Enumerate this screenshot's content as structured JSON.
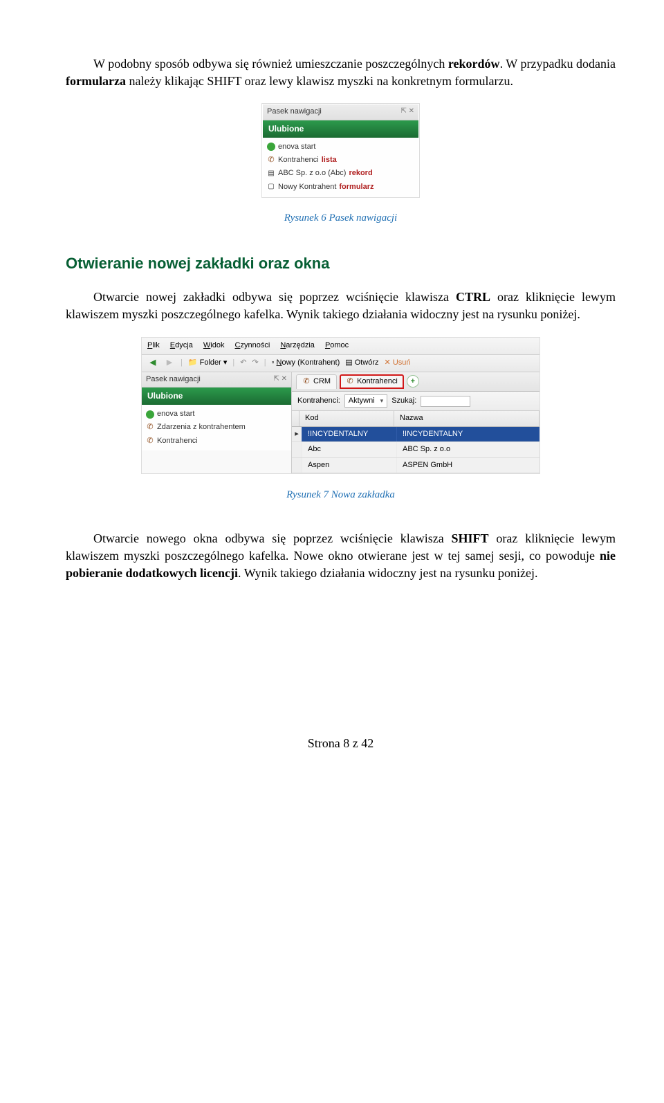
{
  "body": {
    "p1a": "W podobny sposób odbywa się również umieszczanie poszczególnych ",
    "p1b": "rekordów",
    "p1c": ". W przypadku dodania ",
    "p1d": "formularza",
    "p1e": " należy klikając SHIFT oraz lewy klawisz myszki na konkretnym formularzu.",
    "caption1": "Rysunek 6 Pasek nawigacji",
    "section_heading": "Otwieranie nowej zakładki oraz okna",
    "p2a": "Otwarcie nowej zakładki odbywa się poprzez wciśnięcie klawisza ",
    "p2b": "CTRL",
    "p2c": " oraz kliknięcie lewym klawiszem myszki poszczególnego kafelka. Wynik takiego działania widoczny jest na rysunku poniżej.",
    "caption2": "Rysunek 7 Nowa zakładka",
    "p3a": "Otwarcie nowego okna odbywa się poprzez wciśnięcie klawisza ",
    "p3b": "SHIFT",
    "p3c": " oraz kliknięcie lewym klawiszem myszki poszczególnego kafelka. Nowe okno otwierane jest w tej samej sesji, co powoduje ",
    "p3d": "nie pobieranie dodatkowych licencji",
    "p3e": ". Wynik takiego działania widoczny jest na rysunku poniżej."
  },
  "fig1": {
    "title": "Pasek nawigacji",
    "header": "Ulubione",
    "items": [
      {
        "icon": "green-dot",
        "label": "enova start",
        "suffix": ""
      },
      {
        "icon": "phone",
        "label": "Kontrahenci",
        "suffix": "lista"
      },
      {
        "icon": "doc-blue",
        "label": "ABC Sp. z o.o (Abc)",
        "suffix": "rekord"
      },
      {
        "icon": "doc-plain",
        "label": "Nowy Kontrahent",
        "suffix": "formularz"
      }
    ]
  },
  "fig2": {
    "menu": [
      "Plik",
      "Edycja",
      "Widok",
      "Czynności",
      "Narzędzia",
      "Pomoc"
    ],
    "toolbar": {
      "folder": "Folder",
      "new": "Nowy (Kontrahent)",
      "open": "Otwórz",
      "delete": "Usuń"
    },
    "nav": {
      "title": "Pasek nawigacji",
      "header": "Ulubione",
      "items": [
        {
          "icon": "green-dot",
          "label": "enova start"
        },
        {
          "icon": "phone",
          "label": "Zdarzenia z kontrahentem"
        },
        {
          "icon": "phone",
          "label": "Kontrahenci"
        }
      ]
    },
    "tabs": {
      "crm": "CRM",
      "kontrahenci": "Kontrahenci"
    },
    "filter": {
      "label": "Kontrahenci:",
      "value": "Aktywni",
      "search_label": "Szukaj:"
    },
    "table": {
      "headers": {
        "kod": "Kod",
        "nazwa": "Nazwa"
      },
      "rows": [
        {
          "kod": "!INCYDENTALNY",
          "nazwa": "!INCYDENTALNY",
          "selected": true
        },
        {
          "kod": "Abc",
          "nazwa": "ABC Sp. z o.o",
          "selected": false
        },
        {
          "kod": "Aspen",
          "nazwa": "ASPEN GmbH",
          "selected": false
        }
      ]
    }
  },
  "footer": "Strona 8 z 42"
}
